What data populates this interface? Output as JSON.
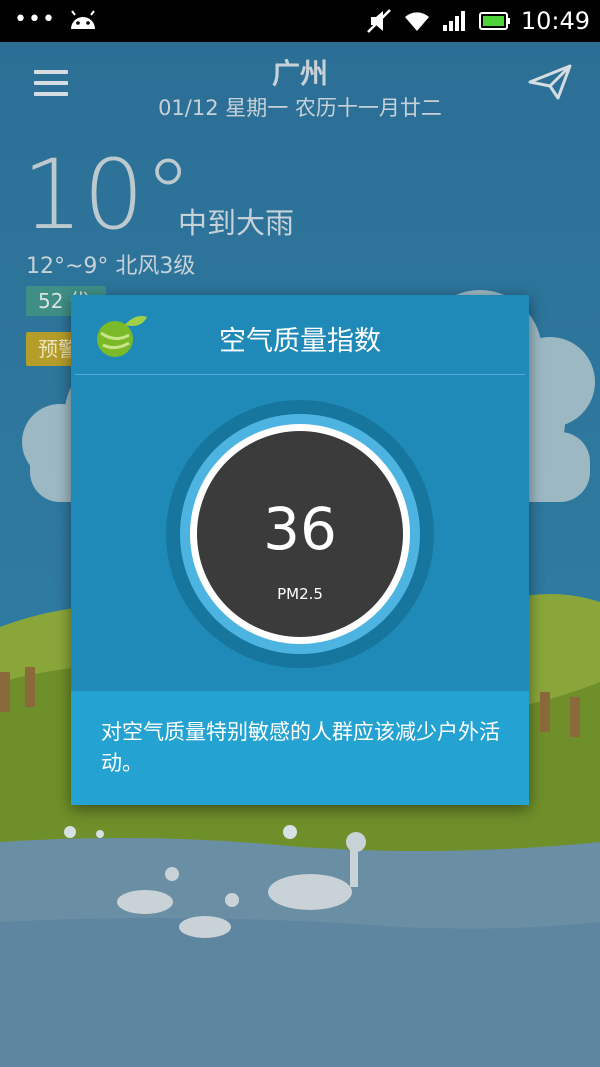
{
  "status_bar": {
    "time": "10:49"
  },
  "header": {
    "city": "广州",
    "date": "01/12 星期一 农历十一月廿二"
  },
  "weather": {
    "temperature": "10°",
    "condition": "中到大雨",
    "range_wind": "12°~9°  北风3级",
    "aqi_badge": "52 优",
    "warning_badge": "预警"
  },
  "dialog": {
    "title": "空气质量指数",
    "value": "36",
    "unit": "PM2.5",
    "advice": "对空气质量特别敏感的人群应该减少户外活动。"
  },
  "colors": {
    "dialog_bg": "#1f8ab8",
    "dialog_footer": "#24a3d2",
    "gauge_fill": "#3c3b3c"
  }
}
